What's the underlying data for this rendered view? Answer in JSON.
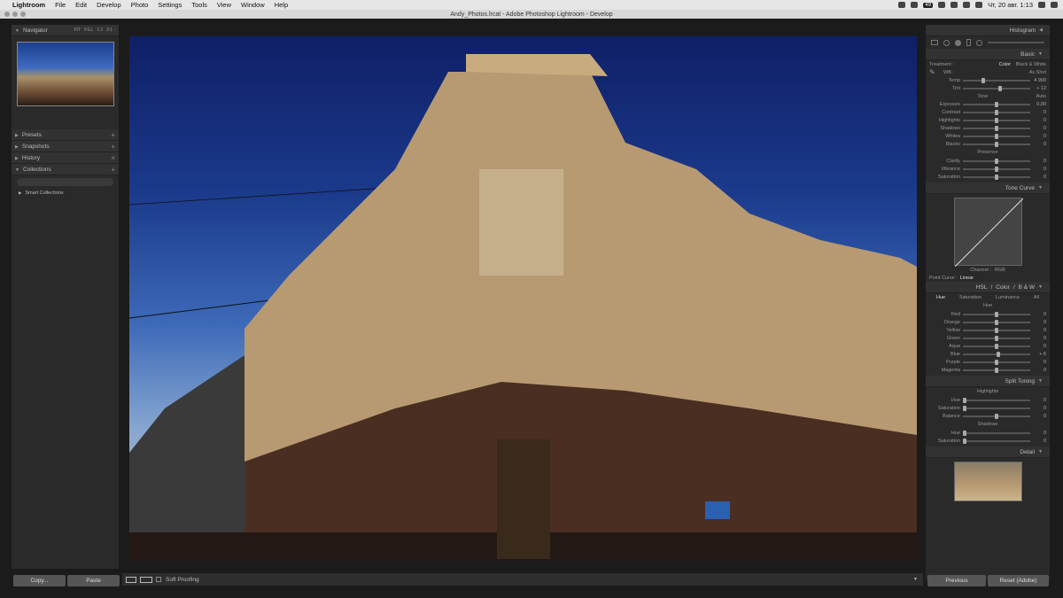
{
  "menubar": {
    "apple": "",
    "app": "Lightroom",
    "items": [
      "File",
      "Edit",
      "Develop",
      "Photo",
      "Settings",
      "Tools",
      "View",
      "Window",
      "Help"
    ],
    "battery": "49",
    "datetime": "Чт, 20 авг. 1:13"
  },
  "window": {
    "title": "Andy_Photos.lrcat - Adobe Photoshop Lightroom - Develop"
  },
  "left": {
    "navigator": "Navigator",
    "nav_zoom": [
      "FIT",
      "FILL",
      "1:1",
      "3:1 :"
    ],
    "presets": "Presets",
    "snapshots": "Snapshots",
    "history": "History",
    "collections": "Collections",
    "smart": "Smart Collections",
    "copy": "Copy...",
    "paste": "Paste"
  },
  "toolbar": {
    "soft_proofing": "Soft Proofing"
  },
  "right": {
    "histogram": "Histogram",
    "basic": "Basic",
    "treatment": "Treatment :",
    "color": "Color",
    "bw": "Black & White",
    "wb": "WB :",
    "as_shot": "As Shot",
    "temp_rows": [
      {
        "label": "Temp",
        "value": "4 900",
        "pos": 0.3
      },
      {
        "label": "Tint",
        "value": "+ 12",
        "pos": 0.55
      }
    ],
    "tone": "Tone",
    "auto": "Auto",
    "tone_rows": [
      {
        "label": "Exposure",
        "value": "0,00",
        "pos": 0.5
      },
      {
        "label": "Contrast",
        "value": "0",
        "pos": 0.5
      },
      {
        "label": "Highlights",
        "value": "0",
        "pos": 0.5
      },
      {
        "label": "Shadows",
        "value": "0",
        "pos": 0.5
      },
      {
        "label": "Whites",
        "value": "0",
        "pos": 0.5
      },
      {
        "label": "Blacks",
        "value": "0",
        "pos": 0.5
      }
    ],
    "presence": "Presence",
    "presence_rows": [
      {
        "label": "Clarity",
        "value": "0",
        "pos": 0.5
      },
      {
        "label": "Vibrance",
        "value": "0",
        "pos": 0.5
      },
      {
        "label": "Saturation",
        "value": "0",
        "pos": 0.5
      }
    ],
    "tone_curve": "Tone Curve",
    "channel": "Channel :",
    "rgb": "RGB",
    "point_curve": "Point Curve :",
    "linear": "Linear",
    "hsl": "HSL",
    "hsl_color": "Color",
    "hsl_bw": "B & W",
    "hsl_tabs": [
      "Hue",
      "Saturation",
      "Luminance",
      "All"
    ],
    "hue_head": "Hue",
    "hue_rows": [
      {
        "label": "Red",
        "value": "0",
        "pos": 0.5
      },
      {
        "label": "Orange",
        "value": "0",
        "pos": 0.5
      },
      {
        "label": "Yellow",
        "value": "0",
        "pos": 0.5
      },
      {
        "label": "Green",
        "value": "0",
        "pos": 0.5
      },
      {
        "label": "Aqua",
        "value": "0",
        "pos": 0.5
      },
      {
        "label": "Blue",
        "value": "+ 6",
        "pos": 0.53
      },
      {
        "label": "Purple",
        "value": "0",
        "pos": 0.5
      },
      {
        "label": "Magenta",
        "value": "0",
        "pos": 0.5
      }
    ],
    "split_toning": "Split Toning",
    "highlights": "Highlights",
    "shadows": "Shadows",
    "split_hl": [
      {
        "label": "Hue",
        "value": "0",
        "pos": 0.02
      },
      {
        "label": "Saturation",
        "value": "0",
        "pos": 0.02
      }
    ],
    "balance": {
      "label": "Balance",
      "value": "0",
      "pos": 0.5
    },
    "split_sh": [
      {
        "label": "Hue",
        "value": "0",
        "pos": 0.02
      },
      {
        "label": "Saturation",
        "value": "0",
        "pos": 0.02
      }
    ],
    "detail": "Detail",
    "previous": "Previous",
    "reset": "Reset (Adobe)"
  }
}
